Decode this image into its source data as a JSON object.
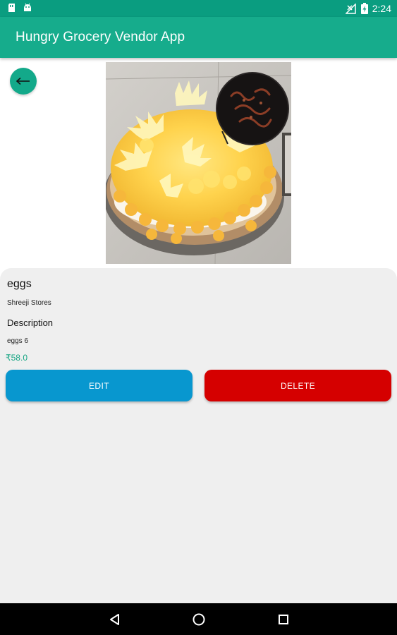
{
  "status_bar": {
    "time": "2:24",
    "icons": [
      "sd-card-icon",
      "android-icon",
      "no-signal-icon",
      "battery-charging-icon"
    ]
  },
  "app_bar": {
    "title": "Hungry Grocery Vendor App"
  },
  "colors": {
    "status_bar": "#0a9d80",
    "app_bar": "#16ac8c",
    "back_button": "#13a98a",
    "card_background": "#efefef",
    "price": "#16a583",
    "edit_button": "#0897cf",
    "delete_button": "#d50000",
    "navigation_bar": "#000000"
  },
  "product": {
    "image_icon": "cake-photo",
    "name": "eggs",
    "store": "Shreeji Stores",
    "description_heading": "Description",
    "description": "eggs 6",
    "price": "₹58.0"
  },
  "actions": {
    "edit_label": "EDIT",
    "delete_label": "DELETE"
  },
  "navigation": {
    "back_icon": "back-triangle-icon",
    "home_icon": "home-circle-icon",
    "recents_icon": "recents-square-icon"
  }
}
